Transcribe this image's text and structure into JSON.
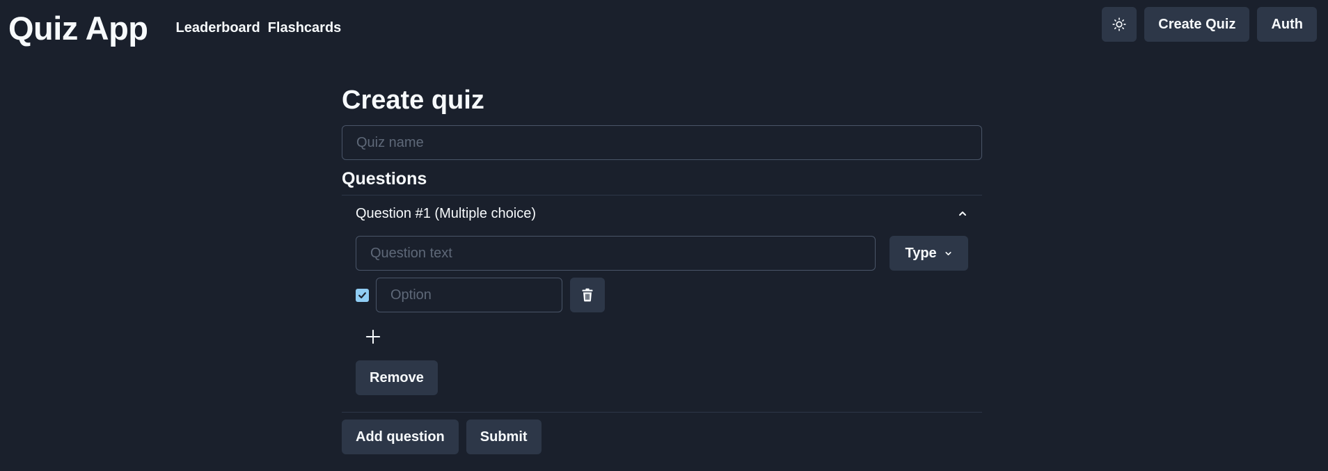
{
  "header": {
    "brand": "Quiz App",
    "nav": [
      "Leaderboard",
      "Flashcards"
    ],
    "theme_icon": "sun-icon",
    "create_quiz": "Create Quiz",
    "auth": "Auth"
  },
  "page": {
    "title": "Create quiz",
    "quiz_name_placeholder": "Quiz name",
    "quiz_name_value": ""
  },
  "questions": {
    "heading": "Questions",
    "items": [
      {
        "title": "Question #1 (Multiple choice)",
        "expanded_icon": "chevron-up-icon",
        "text_placeholder": "Question text",
        "text_value": "",
        "type_label": "Type",
        "options": [
          {
            "placeholder": "Option",
            "value": "",
            "checked": true
          }
        ],
        "add_option_icon": "plus-icon",
        "remove_label": "Remove"
      }
    ]
  },
  "footer": {
    "add_question": "Add question",
    "submit": "Submit"
  },
  "colors": {
    "background": "#1a202c",
    "button_bg": "#2d3748",
    "border": "#4a5568",
    "checkbox_accent": "#90cdf4",
    "text": "#f7fafc"
  }
}
